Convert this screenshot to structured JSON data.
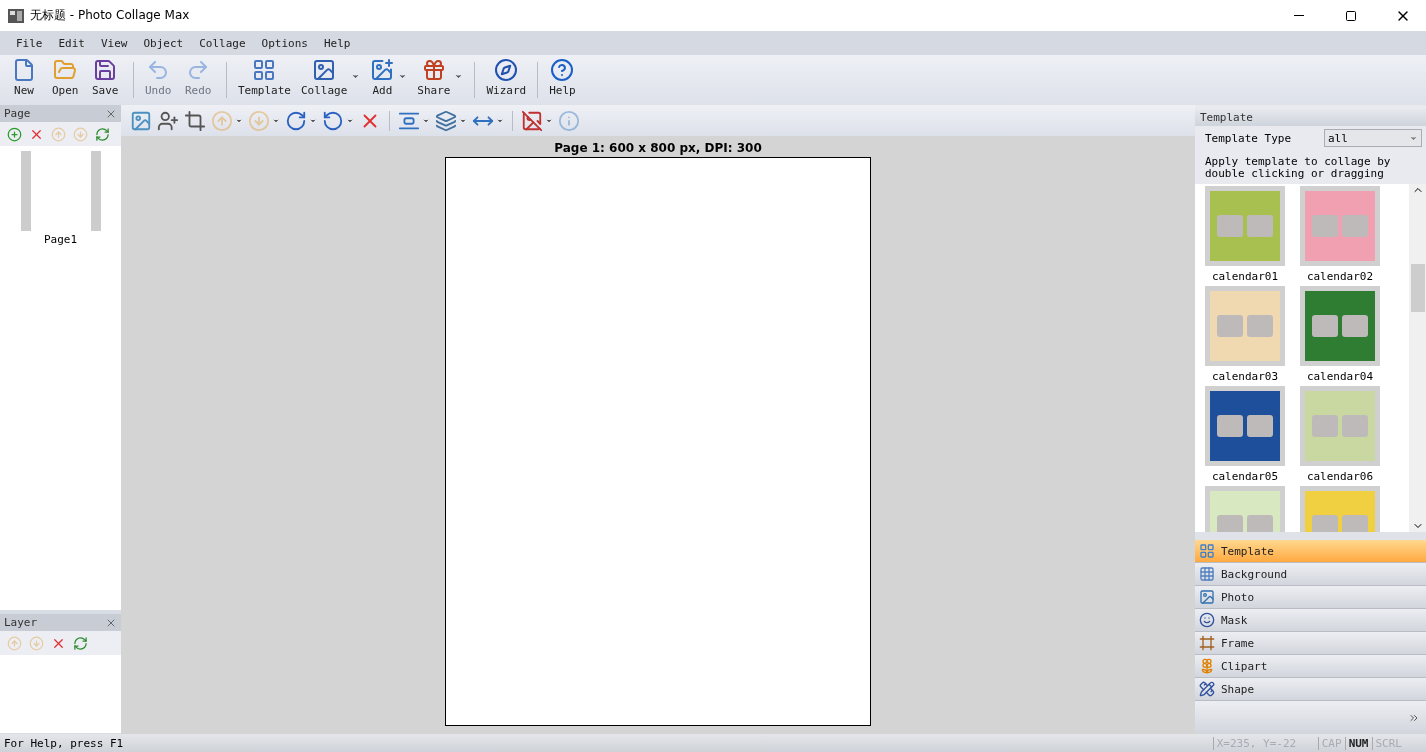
{
  "window": {
    "title": "无标题 - Photo Collage Max"
  },
  "menu": [
    "File",
    "Edit",
    "View",
    "Object",
    "Collage",
    "Options",
    "Help"
  ],
  "toolbar": [
    {
      "kind": "button",
      "label": "New",
      "disabled": false,
      "dropdown": false
    },
    {
      "kind": "button",
      "label": "Open",
      "disabled": false,
      "dropdown": false
    },
    {
      "kind": "button",
      "label": "Save",
      "disabled": false,
      "dropdown": false
    },
    {
      "kind": "separator"
    },
    {
      "kind": "button",
      "label": "Undo",
      "disabled": true,
      "dropdown": false
    },
    {
      "kind": "button",
      "label": "Redo",
      "disabled": true,
      "dropdown": false
    },
    {
      "kind": "separator"
    },
    {
      "kind": "button",
      "label": "Template",
      "disabled": false,
      "dropdown": false
    },
    {
      "kind": "button",
      "label": "Collage",
      "disabled": false,
      "dropdown": true
    },
    {
      "kind": "button",
      "label": "Add",
      "disabled": false,
      "dropdown": true
    },
    {
      "kind": "button",
      "label": "Share",
      "disabled": false,
      "dropdown": true
    },
    {
      "kind": "separator"
    },
    {
      "kind": "button",
      "label": "Wizard",
      "disabled": false,
      "dropdown": false
    },
    {
      "kind": "separator"
    },
    {
      "kind": "button",
      "label": "Help",
      "disabled": false,
      "dropdown": false
    }
  ],
  "page_panel": {
    "title": "Page",
    "tools": [
      {
        "disabled": false
      },
      {
        "disabled": false
      },
      {
        "disabled": true
      },
      {
        "disabled": true
      },
      {
        "disabled": false
      }
    ],
    "pages": [
      {
        "label": "Page1",
        "selected": false
      }
    ]
  },
  "layer_panel": {
    "title": "Layer",
    "tools": [
      {
        "disabled": true
      },
      {
        "disabled": true
      },
      {
        "disabled": false
      },
      {
        "disabled": false
      }
    ]
  },
  "edit_toolbar": [
    {
      "kind": "button",
      "disabled": false,
      "dropdown": false
    },
    {
      "kind": "button",
      "disabled": false,
      "dropdown": false
    },
    {
      "kind": "button",
      "disabled": false,
      "dropdown": false
    },
    {
      "kind": "button",
      "disabled": true,
      "dropdown": true
    },
    {
      "kind": "button",
      "disabled": true,
      "dropdown": true
    },
    {
      "kind": "button",
      "disabled": false,
      "dropdown": true
    },
    {
      "kind": "button",
      "disabled": false,
      "dropdown": true
    },
    {
      "kind": "button",
      "disabled": false,
      "dropdown": false
    },
    {
      "kind": "separator"
    },
    {
      "kind": "button",
      "disabled": false,
      "dropdown": true
    },
    {
      "kind": "button",
      "disabled": false,
      "dropdown": true
    },
    {
      "kind": "button",
      "disabled": false,
      "dropdown": true
    },
    {
      "kind": "separator"
    },
    {
      "kind": "button",
      "disabled": false,
      "dropdown": true
    },
    {
      "kind": "button",
      "disabled": true,
      "dropdown": false
    }
  ],
  "canvas": {
    "caption": "Page 1: 600 x 800 px, DPI: 300"
  },
  "template_panel": {
    "title": "Template",
    "type_label": "Template Type",
    "type_value": "all",
    "hint": "Apply template to collage by double clicking or dragging",
    "templates": [
      {
        "name": "calendar01",
        "color": "#a8c050"
      },
      {
        "name": "calendar02",
        "color": "#f0a0b0"
      },
      {
        "name": "calendar03",
        "color": "#f0d8b0"
      },
      {
        "name": "calendar04",
        "color": "#2e7d32"
      },
      {
        "name": "calendar05",
        "color": "#1e4f9a"
      },
      {
        "name": "calendar06",
        "color": "#c8d8a0"
      },
      {
        "color": "#d8e8c0"
      },
      {
        "color": "#f0d040"
      }
    ]
  },
  "nav": [
    {
      "label": "Template",
      "selected": true
    },
    {
      "label": "Background",
      "selected": false
    },
    {
      "label": "Photo",
      "selected": false
    },
    {
      "label": "Mask",
      "selected": false
    },
    {
      "label": "Frame",
      "selected": false
    },
    {
      "label": "Clipart",
      "selected": false
    },
    {
      "label": "Shape",
      "selected": false
    }
  ],
  "status_bar": {
    "help": "For Help, press F1",
    "coords": "X=235, Y=-22",
    "indicators": [
      {
        "label": "CAP",
        "on": false
      },
      {
        "label": "NUM",
        "on": true
      },
      {
        "label": "SCRL",
        "on": false
      }
    ]
  }
}
